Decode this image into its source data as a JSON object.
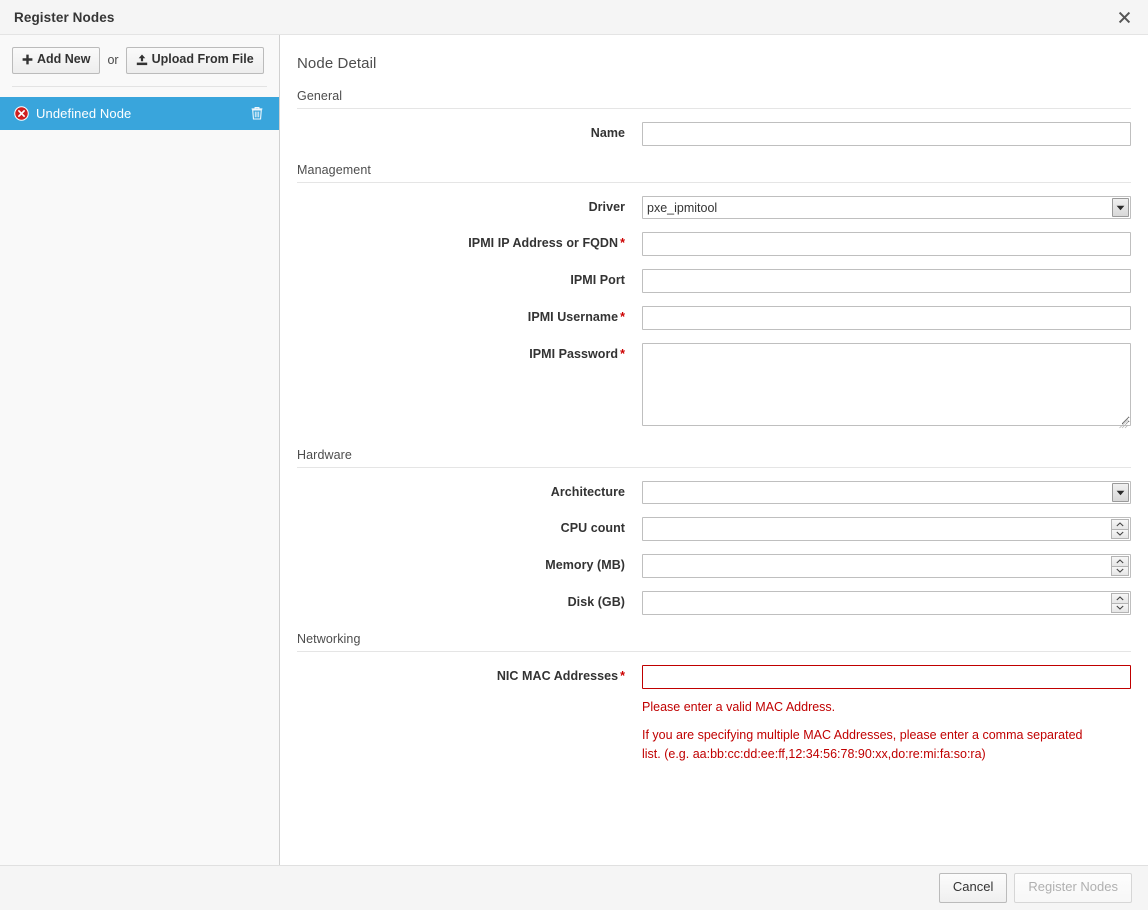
{
  "window": {
    "title": "Register Nodes",
    "close_icon": "close-icon"
  },
  "sidebar": {
    "add_new_label": "Add New",
    "or_label": "or",
    "upload_label": "Upload From File",
    "add_new_icon": "plus-icon",
    "upload_icon": "upload-icon",
    "nodes": [
      {
        "label": "Undefined Node",
        "status_icon": "error-circle-icon",
        "delete_icon": "trash-icon",
        "selected": true
      }
    ]
  },
  "panel": {
    "title": "Node Detail",
    "sections": [
      {
        "heading": "General",
        "fields": [
          {
            "label": "Name",
            "required": false,
            "type": "text",
            "value": ""
          }
        ]
      },
      {
        "heading": "Management",
        "fields": [
          {
            "label": "Driver",
            "required": false,
            "type": "select",
            "value": "pxe_ipmitool",
            "options": [
              "pxe_ipmitool"
            ]
          },
          {
            "label": "IPMI IP Address or FQDN",
            "required": true,
            "type": "text",
            "value": ""
          },
          {
            "label": "IPMI Port",
            "required": false,
            "type": "text",
            "value": ""
          },
          {
            "label": "IPMI Username",
            "required": true,
            "type": "text",
            "value": ""
          },
          {
            "label": "IPMI Password",
            "required": true,
            "type": "textarea",
            "value": ""
          }
        ]
      },
      {
        "heading": "Hardware",
        "fields": [
          {
            "label": "Architecture",
            "required": false,
            "type": "select",
            "value": "",
            "options": [
              ""
            ]
          },
          {
            "label": "CPU count",
            "required": false,
            "type": "number",
            "value": ""
          },
          {
            "label": "Memory (MB)",
            "required": false,
            "type": "number",
            "value": ""
          },
          {
            "label": "Disk (GB)",
            "required": false,
            "type": "number",
            "value": ""
          }
        ]
      },
      {
        "heading": "Networking",
        "fields": [
          {
            "label": "NIC MAC Addresses",
            "required": true,
            "type": "text",
            "value": "",
            "error": true
          }
        ]
      }
    ],
    "errors": {
      "mac_invalid": "Please enter a valid MAC Address.",
      "mac_hint": "If you are specifying multiple MAC Addresses, please enter a comma separated list. (e.g. aa:bb:cc:dd:ee:ff,12:34:56:78:90:xx,do:re:mi:fa:so:ra)"
    },
    "required_marker": "*"
  },
  "footer": {
    "cancel_label": "Cancel",
    "submit_label": "Register Nodes",
    "submit_disabled": true
  },
  "colors": {
    "accent": "#39a5dc",
    "error": "#c00000",
    "required": "#cc0000"
  }
}
